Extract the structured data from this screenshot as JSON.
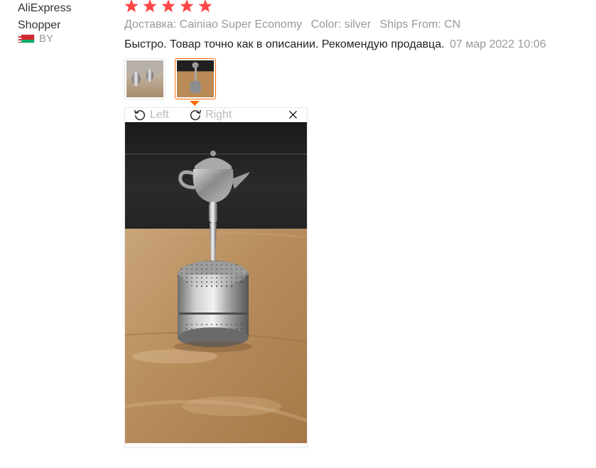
{
  "user": {
    "name": "AliExpress Shopper",
    "country": "BY"
  },
  "review": {
    "stars": 5,
    "star_color": "#ff4747",
    "meta": {
      "shipping": "Доставка: Cainiao Super Economy",
      "color": "Color: silver",
      "ships_from": "Ships From: CN"
    },
    "text": "Быстро. Товар точно как в описании. Рекомендую продавца.",
    "date": "07 мар 2022 10:06"
  },
  "viewer": {
    "rotate_left": "Left",
    "rotate_right": "Right",
    "active_thumb": 2,
    "accent": "#ff6a00"
  }
}
